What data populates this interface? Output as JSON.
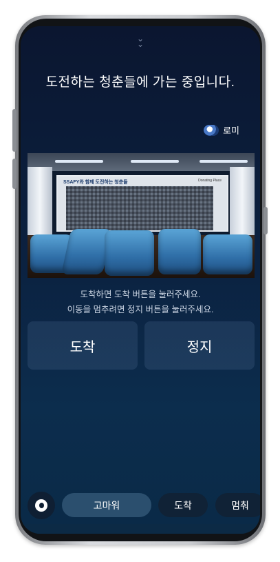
{
  "header": {
    "collapse_glyph": "⌵",
    "title": "도전하는 청춘들에 가는 중입니다."
  },
  "user": {
    "name": "로미"
  },
  "photo": {
    "wall_heading": "SSAFY와 함께 도전하는 청춘들",
    "wall_note": "Donating Place"
  },
  "instructions": {
    "line1": "도착하면 도착 버튼을 눌러주세요.",
    "line2": "이동을 멈추려면 정지 버튼을 눌러주세요."
  },
  "actions": {
    "arrive": "도착",
    "stop": "정지"
  },
  "suggestions": [
    {
      "label": "고마워"
    },
    {
      "label": "도착"
    },
    {
      "label": "멈춰"
    }
  ],
  "colors": {
    "background": "#0b1f3a",
    "chip_active": "#2b4f6e",
    "chip": "#102236"
  }
}
